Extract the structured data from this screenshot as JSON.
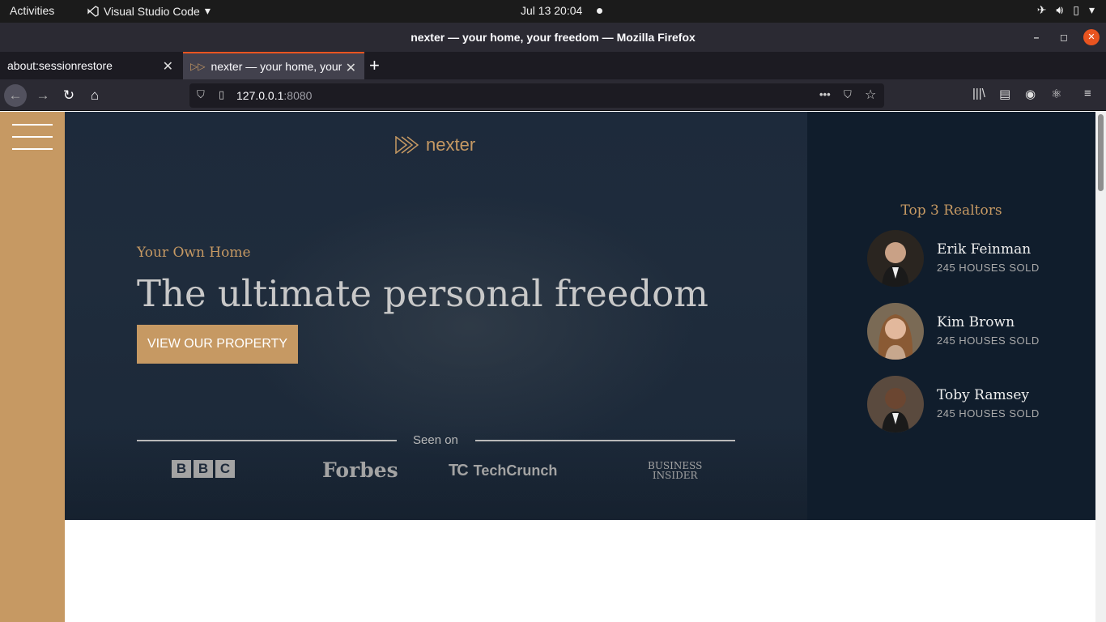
{
  "system": {
    "activities": "Activities",
    "app_name": "Visual Studio Code",
    "clock": "Jul 13  20:04"
  },
  "window": {
    "title": "nexter — your home, your freedom — Mozilla Firefox"
  },
  "tabs": [
    {
      "label": "about:sessionrestore"
    },
    {
      "label": "nexter — your home, your freedom"
    }
  ],
  "navbar": {
    "url_host": "127.0.0.1",
    "url_port": ":8080"
  },
  "page": {
    "logo_text": "nexter",
    "subtitle": "Your Own Home",
    "headline": "The ultimate personal freedom",
    "cta_label": "VIEW OUR PROPERTY",
    "seen_on": "Seen on",
    "press": [
      "BBC",
      "Forbes",
      "TechCrunch",
      "Business Insider"
    ],
    "realtors_title": "Top 3 Realtors",
    "realtors": [
      {
        "name": "Erik Feinman",
        "sold": "245 HOUSES SOLD"
      },
      {
        "name": "Kim Brown",
        "sold": "245 HOUSES SOLD"
      },
      {
        "name": "Toby Ramsey",
        "sold": "245 HOUSES SOLD"
      }
    ]
  },
  "colors": {
    "accent": "#c69963",
    "hero_bg": "#1d2a3b",
    "realtors_bg": "#101d2c",
    "firefox_accent": "#e95420"
  }
}
